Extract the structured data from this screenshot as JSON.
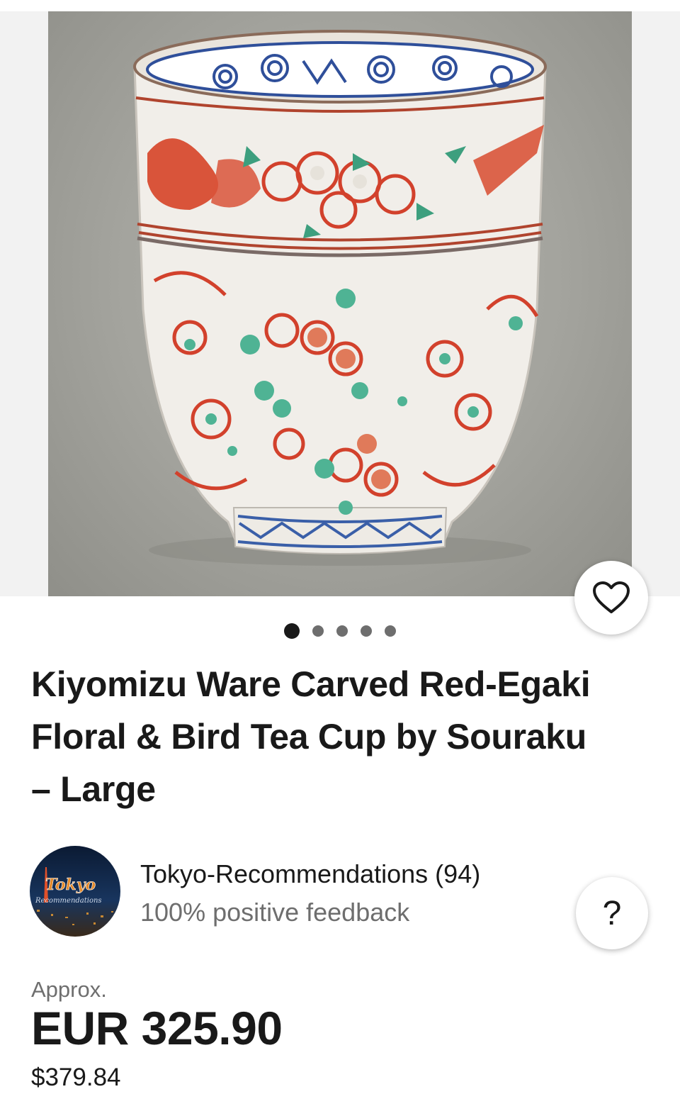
{
  "product": {
    "title": "Kiyomizu Ware Carved Red-Egaki Floral & Bird Tea Cup by Souraku – Large",
    "image_count": 5,
    "active_image_index": 0
  },
  "seller": {
    "name_with_count": "Tokyo-Recommendations (94)",
    "feedback": "100% positive feedback",
    "avatar_text_main": "Tokyo",
    "avatar_text_sub": "Recommendations"
  },
  "price": {
    "approx_label": "Approx.",
    "amount": "EUR 325.90",
    "converted": "$379.84"
  },
  "help_button": {
    "label": "?"
  },
  "icons": {
    "favorite": "heart-outline-icon",
    "help": "question-mark-icon"
  }
}
